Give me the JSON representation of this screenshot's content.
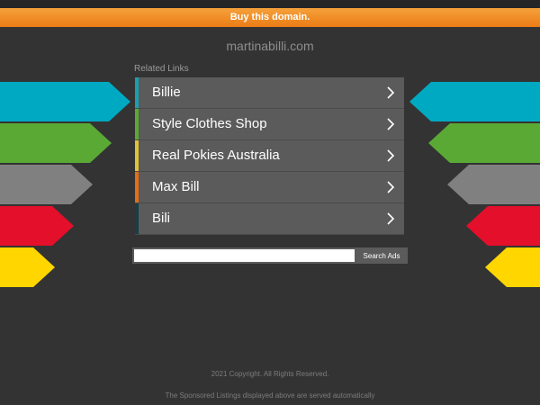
{
  "buy_bar": {
    "label": "Buy this domain."
  },
  "domain": "martinabilli.com",
  "related_links_label": "Related Links",
  "links": [
    {
      "label": "Billie",
      "color": "#1a9fae"
    },
    {
      "label": "Style Clothes Shop",
      "color": "#5aa935"
    },
    {
      "label": "Real Pokies Australia",
      "color": "#e0c23a"
    },
    {
      "label": "Max Bill",
      "color": "#e26e16"
    },
    {
      "label": "Bili",
      "color": "#183e48"
    }
  ],
  "search": {
    "button_label": "Search Ads",
    "value": ""
  },
  "decor_colors": {
    "cyan": "#00a9c2",
    "green": "#5aa935",
    "gray": "#808080",
    "red": "#e30f2b",
    "yellow": "#ffd600"
  },
  "footer": {
    "copyright": "2021 Copyright. All Rights Reserved.",
    "disclaimer": "The Sponsored Listings displayed above are served automatically"
  }
}
